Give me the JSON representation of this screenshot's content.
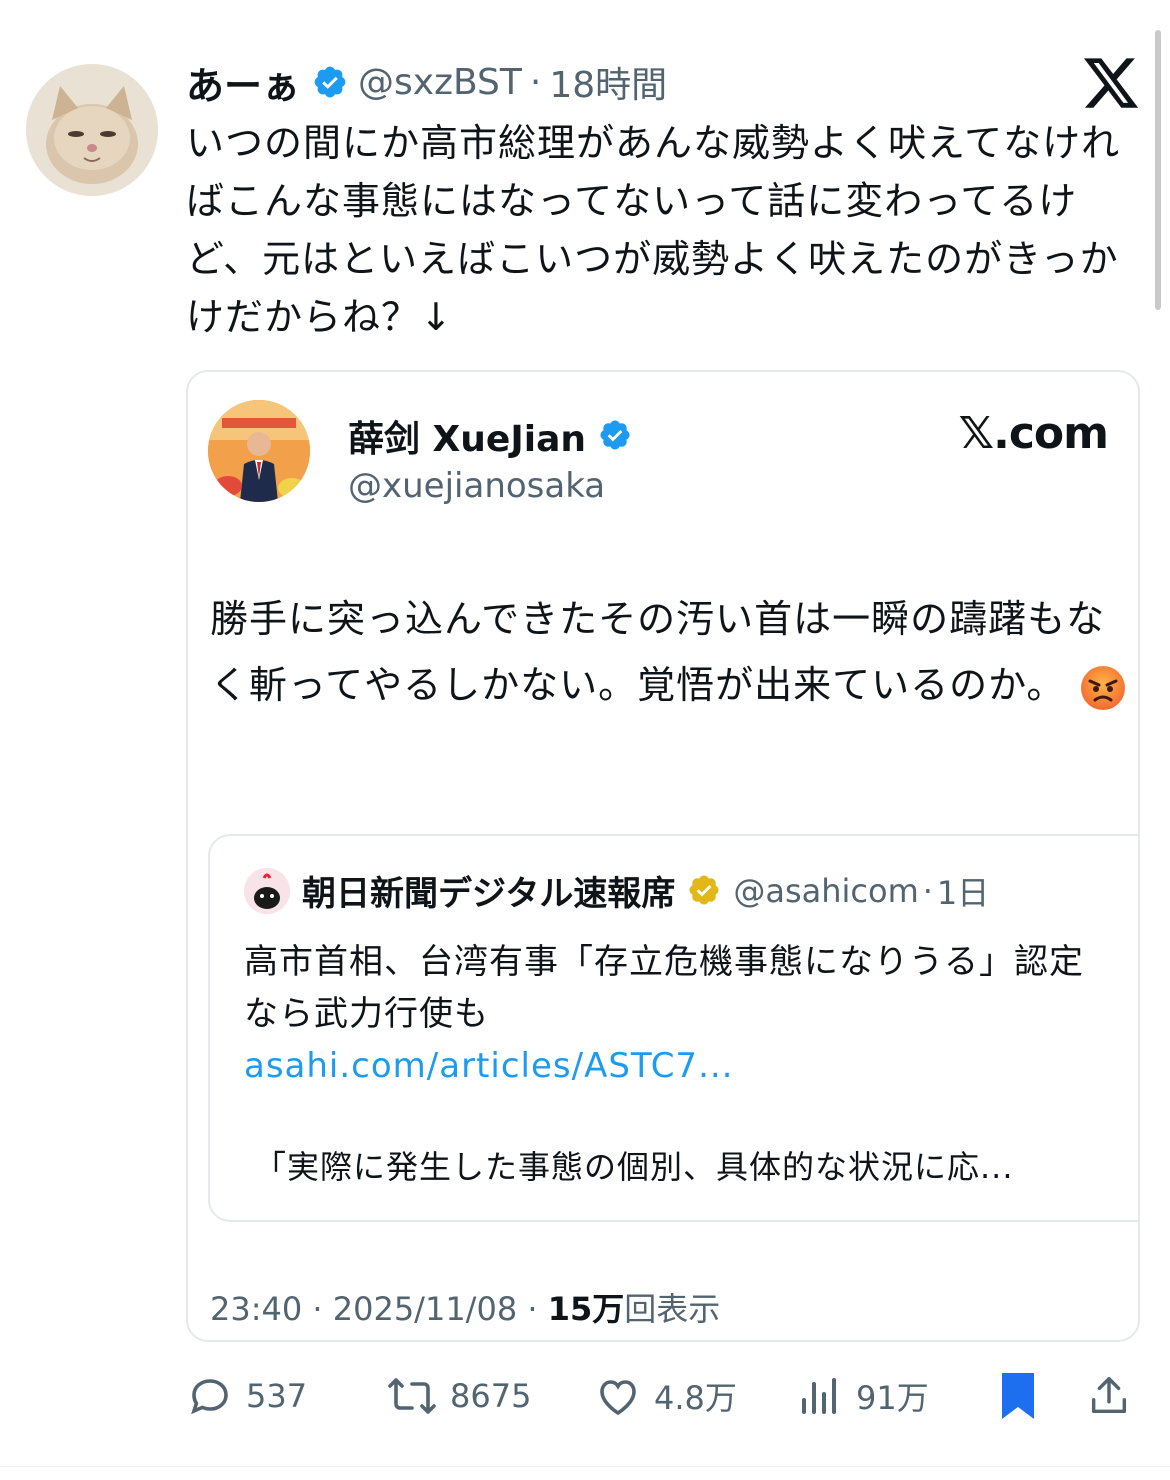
{
  "tweet": {
    "author_name": "あーぁ",
    "author_handle": "@sxzBST",
    "separator": "·",
    "time": "18時間",
    "text": "いつの間にか高市総理があんな威勢よく吠えてなければこんな事態にはなってないって話に変わってるけど、元はといえばこいつが威勢よく吠えたのがきっかけだからね？↓"
  },
  "quoted": {
    "author_name": "薛剑 XueJian",
    "author_handle": "@xuejianosaka",
    "brand": "𝕏.com",
    "text": "勝手に突っ込んできたその汚い首は一瞬の躊躇もなく斬ってやるしかない。覚悟が出来ているのか。",
    "emoji_name": "angry-face-emoji",
    "inner": {
      "author_name": "朝日新聞デジタル速報席",
      "author_handle": "@asahicom",
      "separator": "·",
      "time": "1日",
      "text": "高市首相、台湾有事「存立危機事態になりうる」認定なら武力行使も",
      "link": "asahi.com/articles/ASTC7...",
      "description": "「実際に発生した事態の個別、具体的な状況に応..."
    },
    "meta": {
      "time": "23:40",
      "separator": "·",
      "date": "2025/11/08",
      "views_count": "15万",
      "views_label": "回表示"
    }
  },
  "actions": {
    "replies": "537",
    "reposts": "8675",
    "likes": "4.8万",
    "views": "91万"
  },
  "colors": {
    "verified_blue": "#1d9bf0",
    "verified_gold": "#e2b719",
    "bookmark_active": "#1d6ff0",
    "secondary_text": "#536471"
  },
  "icons": [
    "verified-badge-icon",
    "x-logo-icon",
    "reply-icon",
    "repost-icon",
    "like-icon",
    "views-icon",
    "bookmark-icon",
    "share-icon"
  ]
}
